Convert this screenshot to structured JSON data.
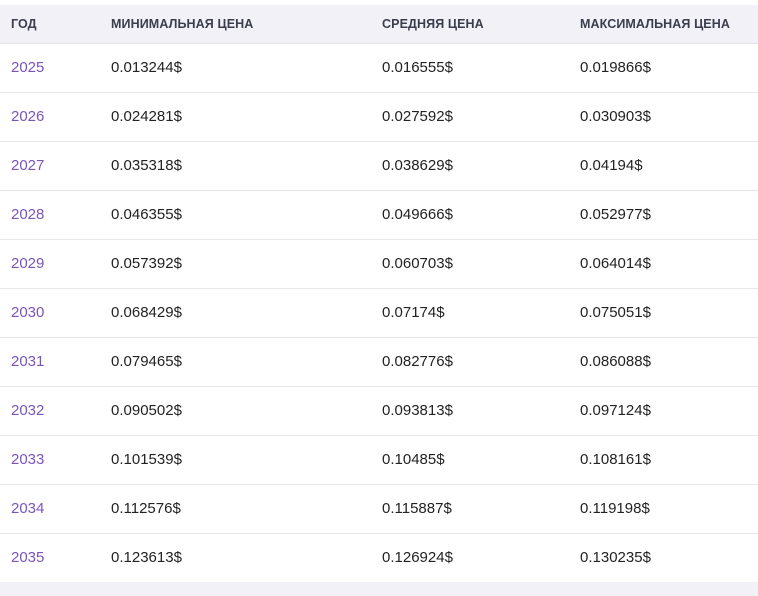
{
  "table": {
    "headers": [
      "ГОД",
      "МИНИМАЛЬНАЯ ЦЕНА",
      "СРЕДНЯЯ ЦЕНА",
      "МАКСИМАЛЬНАЯ ЦЕНА"
    ],
    "rows": [
      {
        "year": "2025",
        "min": "0.013244$",
        "avg": "0.016555$",
        "max": "0.019866$"
      },
      {
        "year": "2026",
        "min": "0.024281$",
        "avg": "0.027592$",
        "max": "0.030903$"
      },
      {
        "year": "2027",
        "min": "0.035318$",
        "avg": "0.038629$",
        "max": "0.04194$"
      },
      {
        "year": "2028",
        "min": "0.046355$",
        "avg": "0.049666$",
        "max": "0.052977$"
      },
      {
        "year": "2029",
        "min": "0.057392$",
        "avg": "0.060703$",
        "max": "0.064014$"
      },
      {
        "year": "2030",
        "min": "0.068429$",
        "avg": "0.07174$",
        "max": "0.075051$"
      },
      {
        "year": "2031",
        "min": "0.079465$",
        "avg": "0.082776$",
        "max": "0.086088$"
      },
      {
        "year": "2032",
        "min": "0.090502$",
        "avg": "0.093813$",
        "max": "0.097124$"
      },
      {
        "year": "2033",
        "min": "0.101539$",
        "avg": "0.10485$",
        "max": "0.108161$"
      },
      {
        "year": "2034",
        "min": "0.112576$",
        "avg": "0.115887$",
        "max": "0.119198$"
      },
      {
        "year": "2035",
        "min": "0.123613$",
        "avg": "0.126924$",
        "max": "0.130235$"
      }
    ]
  },
  "colors": {
    "year_link": "#7a55b8",
    "header_bg": "#f1f1f7",
    "header_text": "#3b3d4d",
    "cell_text": "#222222"
  }
}
